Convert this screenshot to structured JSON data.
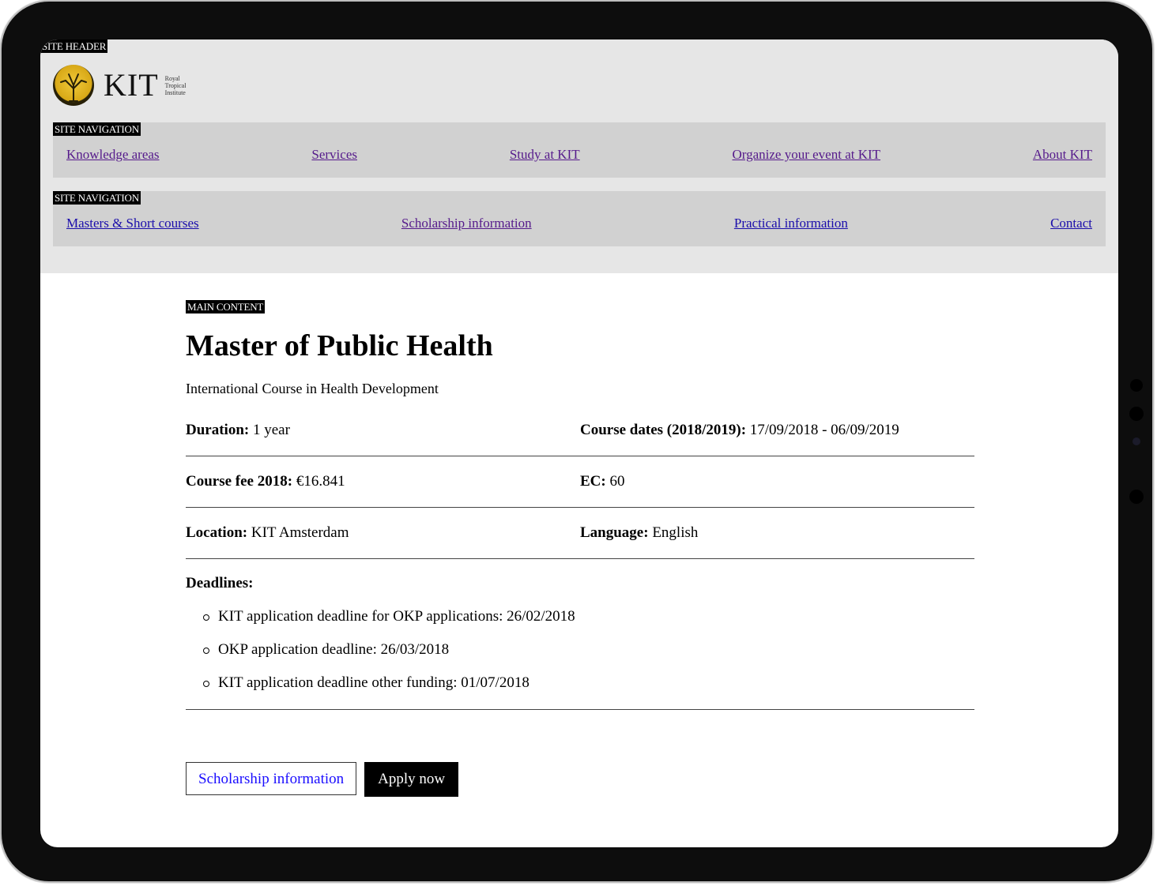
{
  "header": {
    "region_label": "SITE HEADER",
    "logo_word": "KIT",
    "logo_sub": [
      "Royal",
      "Tropical",
      "Institute"
    ]
  },
  "primary_nav": {
    "region_label": "SITE NAVIGATION",
    "items": [
      "Knowledge areas",
      "Services",
      "Study at KIT",
      "Organize your event at KIT",
      "About KIT"
    ]
  },
  "secondary_nav": {
    "region_label": "SITE NAVIGATION",
    "items": [
      "Masters & Short courses",
      "Scholarship information",
      "Practical information",
      "Contact"
    ]
  },
  "main": {
    "region_label": "MAIN CONTENT",
    "title": "Master of Public Health",
    "subtitle": "International Course in Health Development",
    "details": [
      {
        "label": "Duration:",
        "value": "1 year"
      },
      {
        "label": "Course dates (2018/2019):",
        "value": "17/09/2018 - 06/09/2019"
      },
      {
        "label": "Course fee 2018:",
        "value": "€16.841"
      },
      {
        "label": "EC:",
        "value": "60"
      },
      {
        "label": "Location:",
        "value": "KIT Amsterdam"
      },
      {
        "label": "Language:",
        "value": "English"
      }
    ],
    "deadlines_title": "Deadlines:",
    "deadlines": [
      "KIT application deadline for OKP applications: 26/02/2018",
      "OKP application deadline: 26/03/2018",
      "KIT application deadline other funding: 01/07/2018"
    ],
    "scholarship_button": "Scholarship information",
    "apply_button": "Apply now"
  },
  "colors": {
    "visited_link": "#551a8b",
    "unvisited_link": "#1a0dab",
    "header_bg": "#e6e6e6",
    "nav_bg": "#d1d1d1"
  }
}
